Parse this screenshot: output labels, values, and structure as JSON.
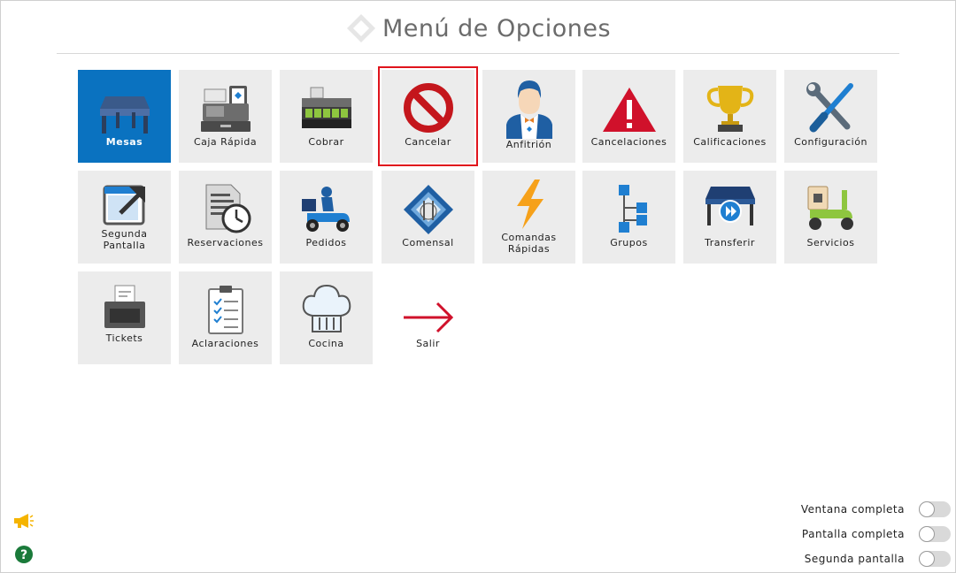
{
  "header": {
    "title": "Menú de Opciones"
  },
  "tiles": [
    {
      "label": "Mesas",
      "icon": "table-icon"
    },
    {
      "label": "Caja Rápida",
      "icon": "cash-register-icon"
    },
    {
      "label": "Cobrar",
      "icon": "cash-drawer-icon"
    },
    {
      "label": "Cancelar",
      "icon": "prohibited-icon"
    },
    {
      "label": "Anfitrión",
      "icon": "host-icon"
    },
    {
      "label": "Cancelaciones",
      "icon": "warning-icon"
    },
    {
      "label": "Calificaciones",
      "icon": "trophy-icon"
    },
    {
      "label": "Configuración",
      "icon": "tools-icon"
    },
    {
      "label": "Segunda Pantalla",
      "icon": "external-window-icon"
    },
    {
      "label": "Reservaciones",
      "icon": "document-clock-icon"
    },
    {
      "label": "Pedidos",
      "icon": "delivery-scooter-icon"
    },
    {
      "label": "Comensal",
      "icon": "diner-icon"
    },
    {
      "label": "Comandas Rápidas",
      "icon": "lightning-icon"
    },
    {
      "label": "Grupos",
      "icon": "hierarchy-icon"
    },
    {
      "label": "Transferir",
      "icon": "transfer-table-icon"
    },
    {
      "label": "Servicios",
      "icon": "service-scooter-icon"
    },
    {
      "label": "Tickets",
      "icon": "ticket-printer-icon"
    },
    {
      "label": "Aclaraciones",
      "icon": "clipboard-checklist-icon"
    },
    {
      "label": "Cocina",
      "icon": "chef-hat-icon"
    },
    {
      "label": "Salir",
      "icon": "arrow-right-icon"
    }
  ],
  "toggles": [
    {
      "label": "Ventana completa",
      "on": false
    },
    {
      "label": "Pantalla completa",
      "on": false
    },
    {
      "label": "Segunda pantalla",
      "on": false
    }
  ],
  "colors": {
    "active_tile": "#0a72c0",
    "tile_bg": "#ececec",
    "selected_outline": "#e0141c",
    "brand_blue": "#1f7fd1"
  }
}
